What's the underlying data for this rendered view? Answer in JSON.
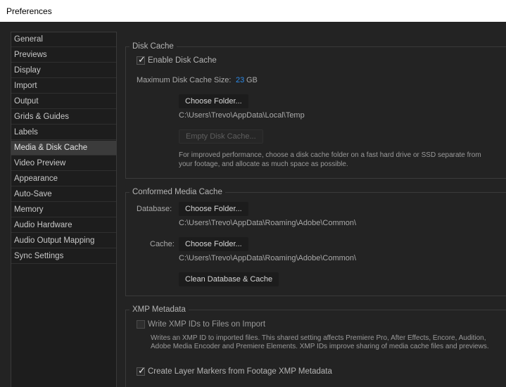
{
  "window": {
    "title": "Preferences"
  },
  "sidebar": {
    "items": [
      {
        "label": "General"
      },
      {
        "label": "Previews"
      },
      {
        "label": "Display"
      },
      {
        "label": "Import"
      },
      {
        "label": "Output"
      },
      {
        "label": "Grids & Guides"
      },
      {
        "label": "Labels"
      },
      {
        "label": "Media & Disk Cache",
        "selected": true
      },
      {
        "label": "Video Preview"
      },
      {
        "label": "Appearance"
      },
      {
        "label": "Auto-Save"
      },
      {
        "label": "Memory"
      },
      {
        "label": "Audio Hardware"
      },
      {
        "label": "Audio Output Mapping"
      },
      {
        "label": "Sync Settings"
      }
    ]
  },
  "disk_cache": {
    "title": "Disk Cache",
    "enable_label": "Enable Disk Cache",
    "enable_checked": true,
    "max_size_label": "Maximum Disk Cache Size:",
    "max_size_value": "23",
    "max_size_unit": "GB",
    "choose_folder": "Choose Folder...",
    "path": "C:\\Users\\Trevo\\AppData\\Local\\Temp",
    "empty_button": "Empty Disk Cache...",
    "note_line1": "For improved performance, choose a disk cache folder on a fast hard drive or SSD separate from",
    "note_line2": "your footage, and allocate as much space as possible."
  },
  "conformed_media_cache": {
    "title": "Conformed Media Cache",
    "database_label": "Database:",
    "database_button": "Choose Folder...",
    "database_path": "C:\\Users\\Trevo\\AppData\\Roaming\\Adobe\\Common\\",
    "cache_label": "Cache:",
    "cache_button": "Choose Folder...",
    "cache_path": "C:\\Users\\Trevo\\AppData\\Roaming\\Adobe\\Common\\",
    "clean_button": "Clean Database & Cache"
  },
  "xmp_metadata": {
    "title": "XMP Metadata",
    "write_ids_label": "Write XMP IDs to Files on Import",
    "write_ids_checked": false,
    "note_line1": "Writes an XMP ID to imported files. This shared setting affects Premiere Pro, After Effects, Encore, Audition,",
    "note_line2": "Adobe Media Encoder and Premiere Elements. XMP IDs improve sharing of media cache files and previews.",
    "layer_markers_label": "Create Layer Markers from Footage XMP Metadata",
    "layer_markers_checked": true
  },
  "colors": {
    "background": "#232323",
    "sidebar_background": "#1d1d1d",
    "selected_item": "#3b3b3b",
    "accent_value": "#2d8ceb"
  }
}
